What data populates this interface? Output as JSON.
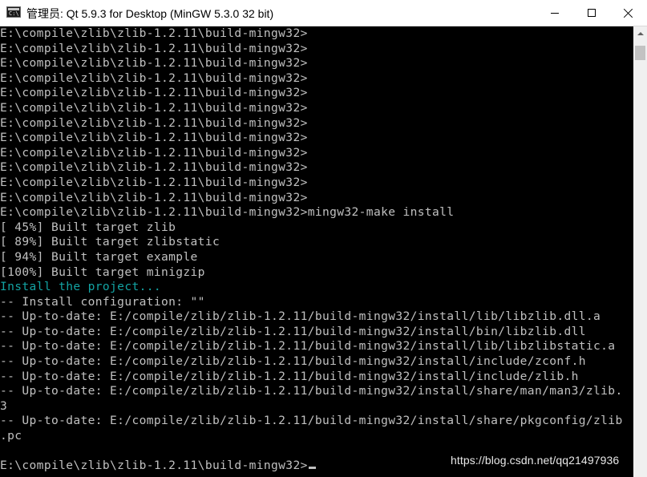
{
  "window": {
    "title": "管理员: Qt 5.9.3 for Desktop (MinGW 5.3.0 32 bit)",
    "icon": "console-icon",
    "app_icon_text": "C:\\"
  },
  "console": {
    "lines": [
      {
        "text": "E:\\compile\\zlib\\zlib-1.2.11\\build-mingw32>",
        "color": "#c0c0c0"
      },
      {
        "text": "E:\\compile\\zlib\\zlib-1.2.11\\build-mingw32>",
        "color": "#c0c0c0"
      },
      {
        "text": "E:\\compile\\zlib\\zlib-1.2.11\\build-mingw32>",
        "color": "#c0c0c0"
      },
      {
        "text": "E:\\compile\\zlib\\zlib-1.2.11\\build-mingw32>",
        "color": "#c0c0c0"
      },
      {
        "text": "E:\\compile\\zlib\\zlib-1.2.11\\build-mingw32>",
        "color": "#c0c0c0"
      },
      {
        "text": "E:\\compile\\zlib\\zlib-1.2.11\\build-mingw32>",
        "color": "#c0c0c0"
      },
      {
        "text": "E:\\compile\\zlib\\zlib-1.2.11\\build-mingw32>",
        "color": "#c0c0c0"
      },
      {
        "text": "E:\\compile\\zlib\\zlib-1.2.11\\build-mingw32>",
        "color": "#c0c0c0"
      },
      {
        "text": "E:\\compile\\zlib\\zlib-1.2.11\\build-mingw32>",
        "color": "#c0c0c0"
      },
      {
        "text": "E:\\compile\\zlib\\zlib-1.2.11\\build-mingw32>",
        "color": "#c0c0c0"
      },
      {
        "text": "E:\\compile\\zlib\\zlib-1.2.11\\build-mingw32>",
        "color": "#c0c0c0"
      },
      {
        "text": "E:\\compile\\zlib\\zlib-1.2.11\\build-mingw32>",
        "color": "#c0c0c0"
      },
      {
        "text": "E:\\compile\\zlib\\zlib-1.2.11\\build-mingw32>mingw32-make install",
        "color": "#c0c0c0"
      },
      {
        "text": "[ 45%] Built target zlib",
        "color": "#c0c0c0"
      },
      {
        "text": "[ 89%] Built target zlibstatic",
        "color": "#c0c0c0"
      },
      {
        "text": "[ 94%] Built target example",
        "color": "#c0c0c0"
      },
      {
        "text": "[100%] Built target minigzip",
        "color": "#c0c0c0"
      },
      {
        "text": "Install the project...",
        "color": "#13a3a3"
      },
      {
        "text": "-- Install configuration: \"\"",
        "color": "#c0c0c0"
      },
      {
        "text": "-- Up-to-date: E:/compile/zlib/zlib-1.2.11/build-mingw32/install/lib/libzlib.dll.a",
        "color": "#c0c0c0"
      },
      {
        "text": "-- Up-to-date: E:/compile/zlib/zlib-1.2.11/build-mingw32/install/bin/libzlib.dll",
        "color": "#c0c0c0"
      },
      {
        "text": "-- Up-to-date: E:/compile/zlib/zlib-1.2.11/build-mingw32/install/lib/libzlibstatic.a",
        "color": "#c0c0c0"
      },
      {
        "text": "-- Up-to-date: E:/compile/zlib/zlib-1.2.11/build-mingw32/install/include/zconf.h",
        "color": "#c0c0c0"
      },
      {
        "text": "-- Up-to-date: E:/compile/zlib/zlib-1.2.11/build-mingw32/install/include/zlib.h",
        "color": "#c0c0c0"
      },
      {
        "text": "-- Up-to-date: E:/compile/zlib/zlib-1.2.11/build-mingw32/install/share/man/man3/zlib.",
        "color": "#c0c0c0"
      },
      {
        "text": "3",
        "color": "#c0c0c0"
      },
      {
        "text": "-- Up-to-date: E:/compile/zlib/zlib-1.2.11/build-mingw32/install/share/pkgconfig/zlib",
        "color": "#c0c0c0"
      },
      {
        "text": ".pc",
        "color": "#c0c0c0"
      },
      {
        "text": "",
        "color": "#c0c0c0"
      },
      {
        "text": "E:\\compile\\zlib\\zlib-1.2.11\\build-mingw32>",
        "color": "#c0c0c0",
        "cursor": true
      }
    ]
  },
  "watermark": {
    "text": "https://blog.csdn.net/qq21497936"
  },
  "colors": {
    "console_bg": "#000000",
    "console_fg": "#c0c0c0",
    "console_cyan": "#13a3a3",
    "titlebar_bg": "#ffffff"
  },
  "icons": {
    "minimize": "minimize-icon",
    "maximize": "maximize-icon",
    "close": "close-icon"
  }
}
